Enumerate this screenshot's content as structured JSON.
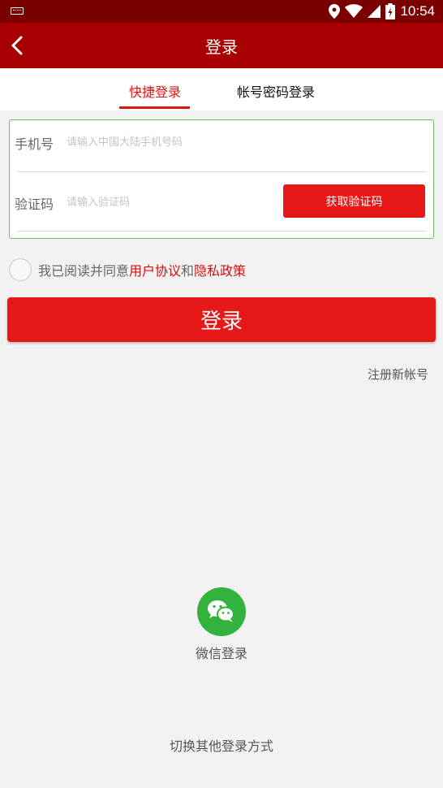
{
  "status_bar": {
    "time": "10:54"
  },
  "header": {
    "title": "登录"
  },
  "tabs": [
    {
      "label": "快捷登录",
      "active": true
    },
    {
      "label": "帐号密码登录",
      "active": false
    }
  ],
  "form": {
    "phone_label": "手机号",
    "phone_placeholder": "请输入中国大陆手机号码",
    "code_label": "验证码",
    "code_placeholder": "请输入验证码",
    "get_code_label": "获取验证码"
  },
  "agreement": {
    "prefix": "我已阅读并同意",
    "user_agreement": "用户协议",
    "and": "和",
    "privacy_policy": "隐私政策"
  },
  "login_button": "登录",
  "register_link": "注册新帐号",
  "wechat_login": "微信登录",
  "switch_login": "切换其他登录方式",
  "colors": {
    "primary_red": "#e61818",
    "header_red": "#a80000",
    "status_bar": "#7a0000",
    "wechat_green": "#33b33d"
  }
}
